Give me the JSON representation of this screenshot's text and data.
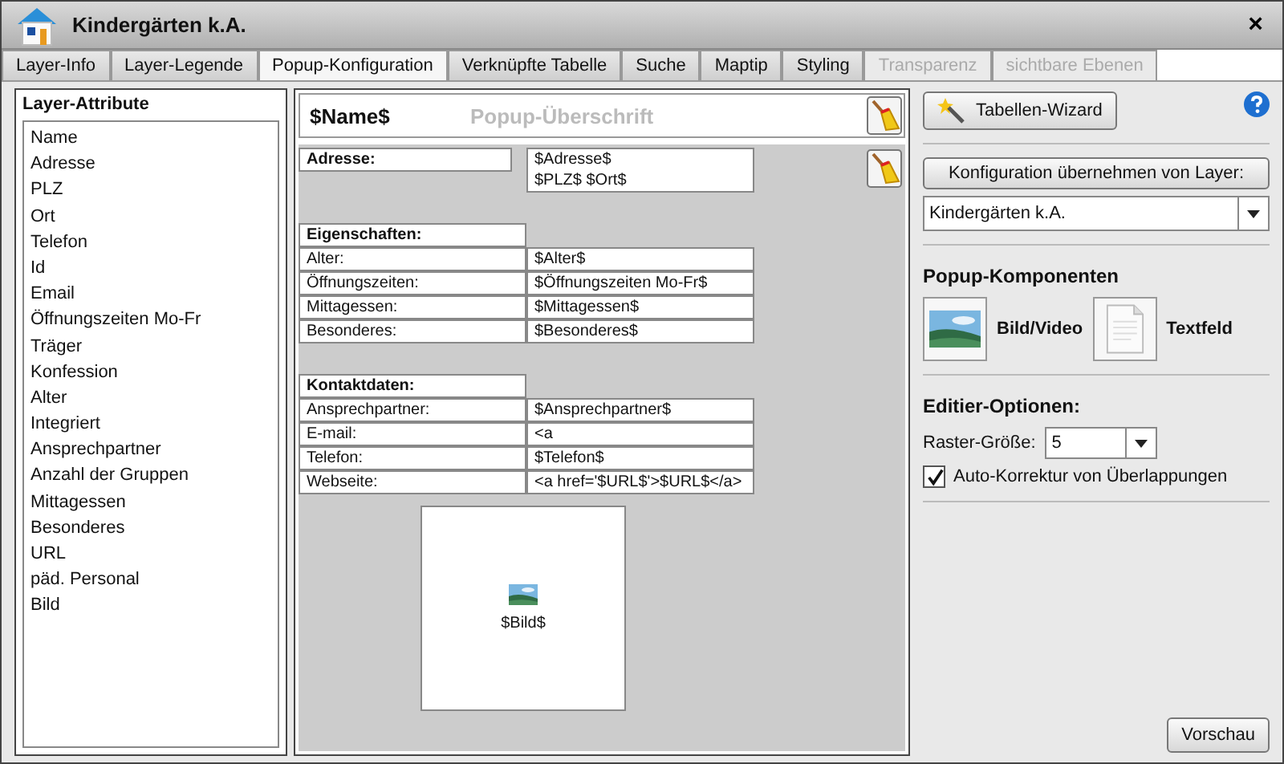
{
  "window": {
    "title": "Kindergärten k.A.",
    "close": "×"
  },
  "tabs": [
    {
      "label": "Layer-Info",
      "selected": false,
      "disabled": false
    },
    {
      "label": "Layer-Legende",
      "selected": false,
      "disabled": false
    },
    {
      "label": "Popup-Konfiguration",
      "selected": true,
      "disabled": false
    },
    {
      "label": "Verknüpfte Tabelle",
      "selected": false,
      "disabled": false
    },
    {
      "label": "Suche",
      "selected": false,
      "disabled": false
    },
    {
      "label": "Maptip",
      "selected": false,
      "disabled": false
    },
    {
      "label": "Styling",
      "selected": false,
      "disabled": false
    },
    {
      "label": "Transparenz",
      "selected": false,
      "disabled": true
    },
    {
      "label": "sichtbare Ebenen",
      "selected": false,
      "disabled": true
    }
  ],
  "attributes": {
    "title": "Layer-Attribute",
    "items": [
      "Name",
      "Adresse",
      "PLZ",
      "Ort",
      "Telefon",
      "Id",
      "Email",
      "Öffnungszeiten Mo-Fr",
      "Träger",
      "Konfession",
      "Alter",
      "Integriert",
      "Ansprechpartner",
      "Anzahl der Gruppen",
      "Mittagessen",
      "Besonderes",
      "URL",
      "päd. Personal",
      "Bild"
    ]
  },
  "canvas": {
    "header_value": "$Name$",
    "header_placeholder": "Popup-Überschrift",
    "blocks": [
      {
        "kind": "address",
        "label": "Adresse:",
        "lines": [
          "$Adresse$",
          "$PLZ$ $Ort$"
        ]
      },
      {
        "kind": "table",
        "title": "Eigenschaften:",
        "rows": [
          [
            "Alter:",
            "$Alter$"
          ],
          [
            "Öffnungszeiten:",
            "$Öffnungszeiten Mo-Fr$"
          ],
          [
            "Mittagessen:",
            "$Mittagessen$"
          ],
          [
            "Besonderes:",
            "$Besonderes$"
          ]
        ]
      },
      {
        "kind": "table",
        "title": "Kontaktdaten:",
        "rows": [
          [
            "Ansprechpartner:",
            "$Ansprechpartner$"
          ],
          [
            "E-mail:",
            "<a"
          ],
          [
            "Telefon:",
            "$Telefon$"
          ],
          [
            "Webseite:",
            "<a href='$URL$'>$URL$</a>"
          ]
        ]
      },
      {
        "kind": "image",
        "label": "$Bild$"
      }
    ]
  },
  "side": {
    "wizard": "Tabellen-Wizard",
    "copy_button": "Konfiguration übernehmen von Layer:",
    "layer_select": "Kindergärten k.A.",
    "components_title": "Popup-Komponenten",
    "components": [
      {
        "kind": "image",
        "label": "Bild/Video"
      },
      {
        "kind": "text",
        "label": "Textfeld"
      }
    ],
    "edit_title": "Editier-Optionen:",
    "grid_label": "Raster-Größe:",
    "grid_value": "5",
    "autocorrect": {
      "label": "Auto-Korrektur von Überlappungen",
      "checked": true
    }
  },
  "preview_button": "Vorschau"
}
